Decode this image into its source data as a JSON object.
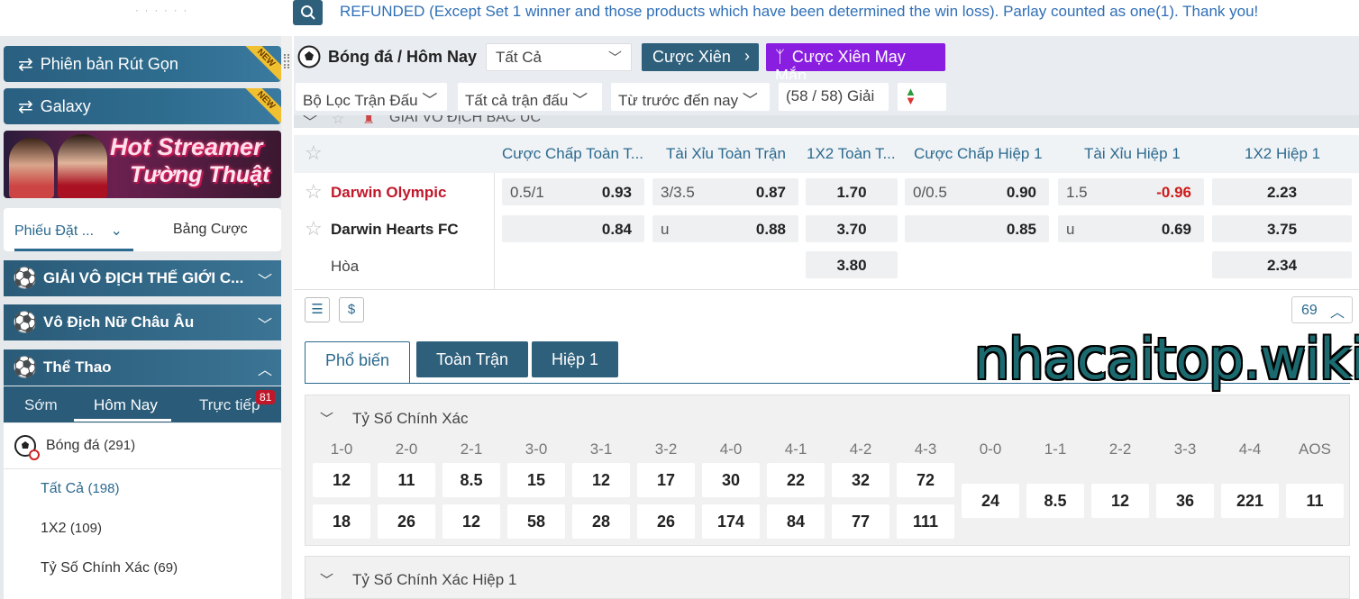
{
  "notice": {
    "text": "REFUNDED (Except Set 1 winner and those products which have been determined the win loss). Parlay counted as one(1). Thank you!"
  },
  "sidebar": {
    "banners": [
      {
        "label": "Phiên bản Rút Gọn",
        "tag": "NEW"
      },
      {
        "label": "Galaxy",
        "tag": "NEW"
      }
    ],
    "hot_banner": {
      "line1": "Hot Streamer",
      "line2": "Tường Thuật"
    },
    "bet_tabs": {
      "slip": "Phiếu Đặt ...",
      "list": "Bảng Cược"
    },
    "sections": [
      {
        "label": "GIẢI VÔ ĐỊCH THẾ GIỚI C..."
      },
      {
        "label": "Vô Địch Nữ Châu Âu"
      },
      {
        "label": "Thể Thao"
      }
    ],
    "sport_tabs": {
      "early": "Sớm",
      "today": "Hôm Nay",
      "live": "Trực tiếp",
      "live_count": "81"
    },
    "sport": {
      "name": "Bóng đá",
      "count": "(291)"
    },
    "items": [
      {
        "name": "Tất Cả",
        "count": "(198)"
      },
      {
        "name": "1X2",
        "count": "(109)"
      },
      {
        "name": "Tỷ Số Chính Xác",
        "count": "(69)"
      }
    ]
  },
  "header": {
    "title": "Bóng đá / Hôm Nay",
    "select_value": "Tất Cả",
    "parlay": "Cược Xiên",
    "lucky": "Cược Xiên May Mắn"
  },
  "filters": {
    "match_filter": "Bộ Lọc Trận Đấu",
    "all_matches": "Tất cả trận đấu",
    "time_range": "Từ trước đến nay",
    "league_count": "(58 / 58) Giải"
  },
  "league": {
    "name": "GIẢI VÔ ĐỊCH BẮC ÚC"
  },
  "odds_columns": [
    "Cược Chấp Toàn T...",
    "Tài Xỉu Toàn Trận",
    "1X2 Toàn T...",
    "Cược Chấp Hiệp 1",
    "Tài Xỉu Hiệp 1",
    "1X2 Hiệp 1"
  ],
  "match": {
    "home": "Darwin Olympic",
    "away": "Darwin Hearts FC",
    "draw": "Hòa",
    "home_hdp_line": "0.5/1",
    "home_hdp": "0.93",
    "home_ou_line": "3/3.5",
    "home_ou": "0.87",
    "home_1x2": "1.70",
    "home_h1_hdp_line": "0/0.5",
    "home_h1_hdp": "0.90",
    "home_h1_ou_line": "1.5",
    "home_h1_ou": "-0.96",
    "home_h1_1x2": "2.23",
    "away_hdp": "0.84",
    "away_ou_line": "u",
    "away_ou": "0.88",
    "away_1x2": "3.70",
    "away_h1_hdp": "0.85",
    "away_h1_ou_line": "u",
    "away_h1_ou": "0.69",
    "away_h1_1x2": "3.75",
    "draw_1x2": "3.80",
    "draw_h1_1x2": "2.34"
  },
  "tools": {
    "count": "69"
  },
  "market_tabs": {
    "popular": "Phổ biến",
    "full": "Toàn Trận",
    "half": "Hiệp 1"
  },
  "watermark": "nhacaitop.wiki",
  "correct_score": {
    "title": "Tỷ Số Chính Xác",
    "headers": [
      "1-0",
      "2-0",
      "2-1",
      "3-0",
      "3-1",
      "3-2",
      "4-0",
      "4-1",
      "4-2",
      "4-3",
      "0-0",
      "1-1",
      "2-2",
      "3-3",
      "4-4",
      "AOS"
    ],
    "row1": [
      "12",
      "11",
      "8.5",
      "15",
      "12",
      "17",
      "30",
      "22",
      "32",
      "72"
    ],
    "row2": [
      "18",
      "26",
      "12",
      "58",
      "28",
      "26",
      "174",
      "84",
      "77",
      "111"
    ],
    "draws": [
      "24",
      "8.5",
      "12",
      "36",
      "221",
      "11"
    ]
  },
  "correct_score_h1": {
    "title": "Tỷ Số Chính Xác Hiệp 1"
  }
}
